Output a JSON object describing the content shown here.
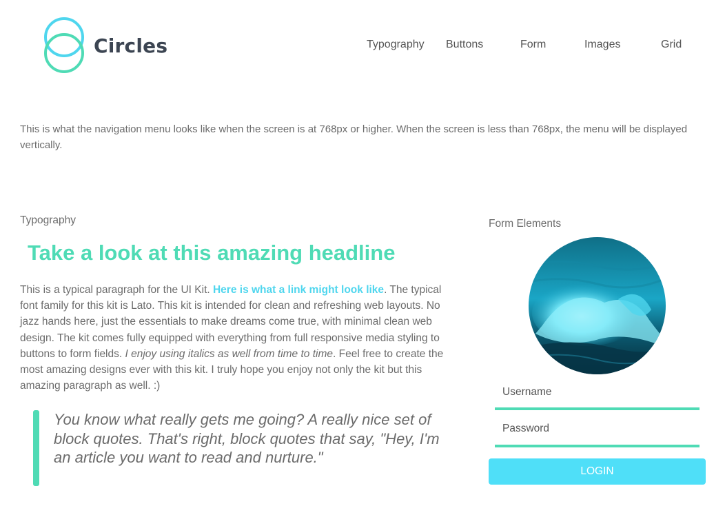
{
  "brand": {
    "name": "Circles",
    "icon": "double-circle-logo-icon",
    "colors": {
      "top": "#4fd6ee",
      "bottom": "#4fdbb5"
    }
  },
  "nav": {
    "items": [
      "Typography",
      "Buttons",
      "Form",
      "Images",
      "Grid"
    ]
  },
  "intro": "This is what the navigation menu looks like when the screen is at 768px or higher. When the screen is less than 768px, the menu will be displayed vertically.",
  "typography": {
    "label": "Typography",
    "headline": "Take a look at this amazing headline",
    "paragraph": {
      "before_link": "This is a typical paragraph for the UI Kit. ",
      "link": "Here is what a link might look like",
      "after_link": ". The typical font family for this kit is Lato. This kit is intended for clean and refreshing web layouts. No jazz hands here, just the essentials to make dreams come true, with minimal clean web design. The kit comes fully equipped with everything from full responsive media styling to buttons to form fields. ",
      "italic": "I enjoy using italics as well from time to time",
      "end": ". Feel free to create the most amazing designs ever with this kit. I truly hope you enjoy not only the kit but this amazing paragraph as well. :)"
    },
    "blockquote": "You know what really gets me going? A really nice set of block quotes. That's right, block quotes that say, \"Hey, I'm an article you want to read and nurture.\""
  },
  "form": {
    "label": "Form Elements",
    "image": "ocean-wave-photo",
    "username_placeholder": "Username",
    "password_placeholder": "Password",
    "login_label": "LOGIN"
  },
  "colors": {
    "accent_green": "#4fdbb5",
    "accent_cyan": "#4fd6ee",
    "button": "#4fdff8",
    "text": "#6b6b6b"
  }
}
